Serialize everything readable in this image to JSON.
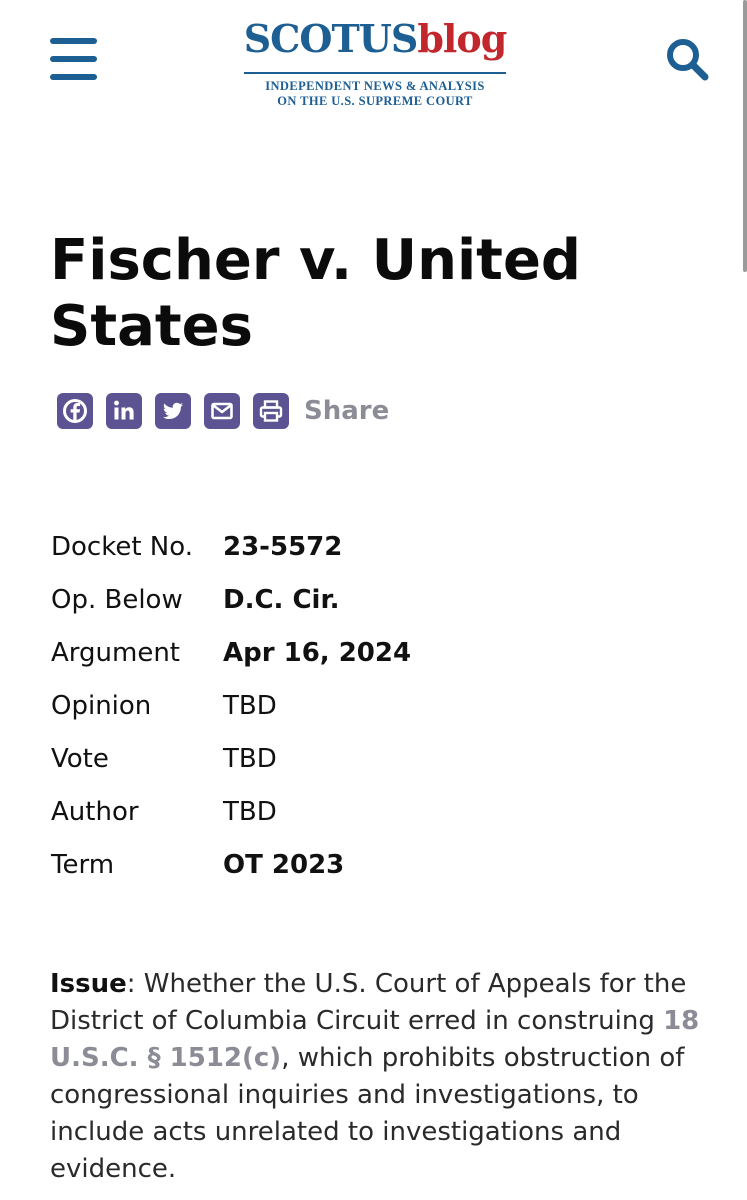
{
  "header": {
    "logo": {
      "name_part1": "SCOTUS",
      "name_part2": "blog",
      "tagline_line1": "INDEPENDENT NEWS & ANALYSIS",
      "tagline_line2": "ON THE U.S. SUPREME COURT"
    },
    "menu_icon": "hamburger-menu-icon",
    "search_icon": "search-icon",
    "colors": {
      "brand_blue": "#1d5e93",
      "brand_red": "#c1272d",
      "share_purple": "#5c5392",
      "muted_gray": "#8b8c96"
    }
  },
  "case": {
    "title": "Fischer v. United States"
  },
  "share": {
    "icons": [
      "facebook-icon",
      "linkedin-icon",
      "twitter-icon",
      "email-icon",
      "print-icon"
    ],
    "label": "Share"
  },
  "details": [
    {
      "label": "Docket No.",
      "value": "23-5572"
    },
    {
      "label": "Op. Below",
      "value": "D.C. Cir."
    },
    {
      "label": "Argument",
      "value": "Apr 16, 2024"
    },
    {
      "label": "Opinion",
      "value": "TBD"
    },
    {
      "label": "Vote",
      "value": "TBD"
    },
    {
      "label": "Author",
      "value": "TBD"
    },
    {
      "label": "Term",
      "value": "OT 2023"
    }
  ],
  "issue": {
    "label": "Issue",
    "text_before_link": ": Whether the U.S. Court of Appeals for the District of Columbia Circuit erred in construing ",
    "link_text": "18 U.S.C. § 1512(c)",
    "text_after_link": ", which prohibits obstruction of congressional inquiries and investigations, to include acts unrelated to investigations and evidence."
  }
}
